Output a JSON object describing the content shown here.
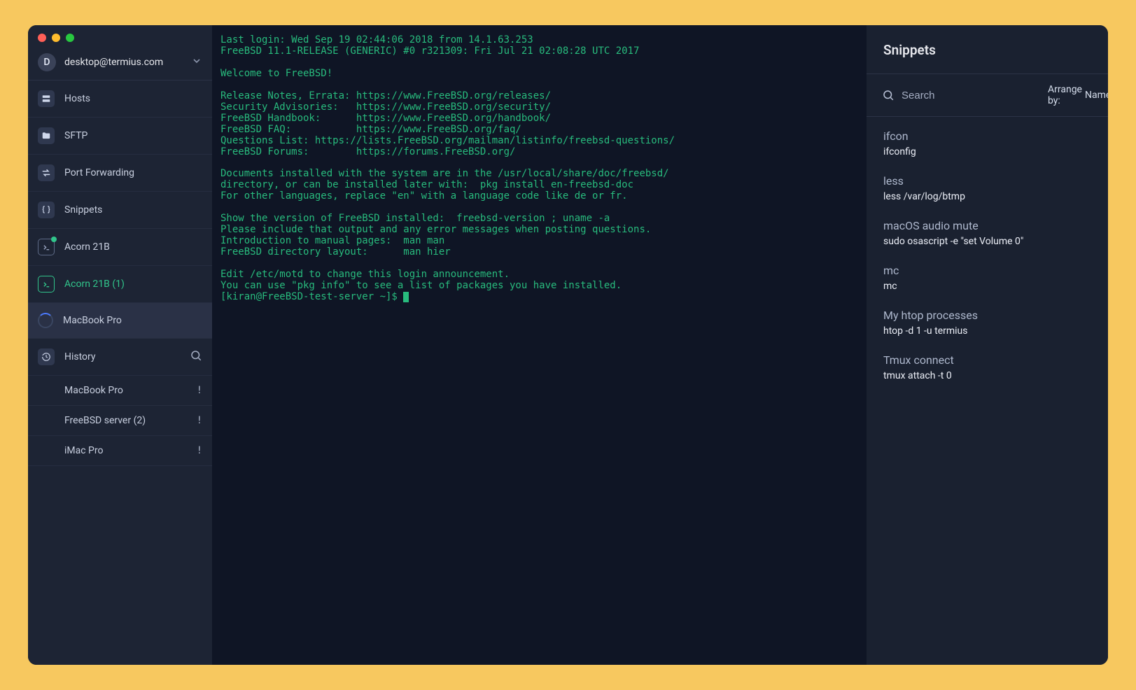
{
  "account": {
    "avatar_letter": "D",
    "email": "desktop@termius.com"
  },
  "sidebar": {
    "nav": [
      {
        "label": "Hosts"
      },
      {
        "label": "SFTP"
      },
      {
        "label": "Port Forwarding"
      },
      {
        "label": "Snippets"
      }
    ],
    "sessions": [
      {
        "label": "Acorn 21B",
        "has_dot": true
      },
      {
        "label": "Acorn 21B (1)",
        "active": true
      },
      {
        "label": "MacBook Pro",
        "loading": true,
        "selected": true
      }
    ],
    "history_label": "History",
    "history": [
      {
        "label": "MacBook Pro",
        "mark": "!"
      },
      {
        "label": "FreeBSD server (2)",
        "mark": "!"
      },
      {
        "label": "iMac Pro",
        "mark": "!"
      }
    ]
  },
  "terminal": {
    "lines": "Last login: Wed Sep 19 02:44:06 2018 from 14.1.63.253\nFreeBSD 11.1-RELEASE (GENERIC) #0 r321309: Fri Jul 21 02:08:28 UTC 2017\n\nWelcome to FreeBSD!\n\nRelease Notes, Errata: https://www.FreeBSD.org/releases/\nSecurity Advisories:   https://www.FreeBSD.org/security/\nFreeBSD Handbook:      https://www.FreeBSD.org/handbook/\nFreeBSD FAQ:           https://www.FreeBSD.org/faq/\nQuestions List: https://lists.FreeBSD.org/mailman/listinfo/freebsd-questions/\nFreeBSD Forums:        https://forums.FreeBSD.org/\n\nDocuments installed with the system are in the /usr/local/share/doc/freebsd/\ndirectory, or can be installed later with:  pkg install en-freebsd-doc\nFor other languages, replace \"en\" with a language code like de or fr.\n\nShow the version of FreeBSD installed:  freebsd-version ; uname -a\nPlease include that output and any error messages when posting questions.\nIntroduction to manual pages:  man man\nFreeBSD directory layout:      man hier\n\nEdit /etc/motd to change this login announcement.\nYou can use \"pkg info\" to see a list of packages you have installed.",
    "prompt": "[kiran@FreeBSD-test-server ~]$ "
  },
  "snippets": {
    "title": "Snippets",
    "search_placeholder": "Search",
    "arrange_label": "Arrange by:",
    "arrange_value": "Name",
    "items": [
      {
        "title": "ifcon",
        "cmd": "ifconfig"
      },
      {
        "title": "less",
        "cmd": "less /var/log/btmp"
      },
      {
        "title": "macOS audio mute",
        "cmd": "sudo osascript -e \"set Volume 0\""
      },
      {
        "title": "mc",
        "cmd": "mc"
      },
      {
        "title": "My htop processes",
        "cmd": "htop -d 1 -u termius"
      },
      {
        "title": "Tmux connect",
        "cmd": "tmux attach -t 0"
      }
    ]
  }
}
